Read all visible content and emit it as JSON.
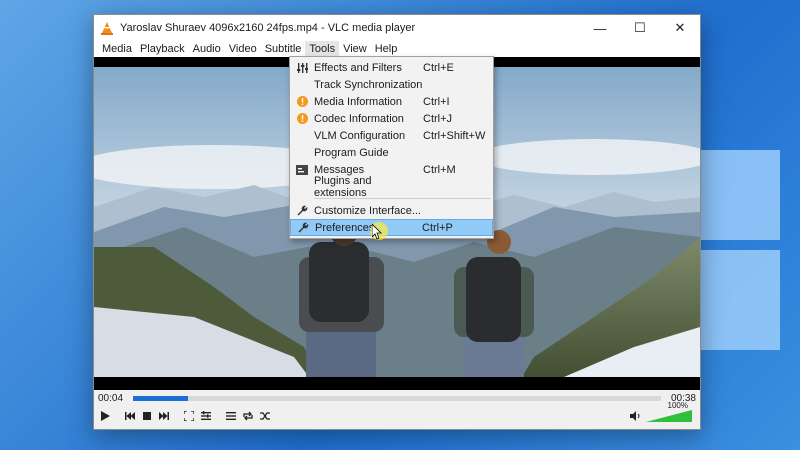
{
  "window": {
    "title": "Yaroslav Shuraev 4096x2160 24fps.mp4 - VLC media player",
    "minimize": "—",
    "maximize": "☐",
    "close": "✕"
  },
  "menubar": [
    "Media",
    "Playback",
    "Audio",
    "Video",
    "Subtitle",
    "Tools",
    "View",
    "Help"
  ],
  "tools_menu": {
    "items": [
      {
        "label": "Effects and Filters",
        "shortcut": "Ctrl+E",
        "icon": "equalizer-icon"
      },
      {
        "label": "Track Synchronization",
        "shortcut": "",
        "icon": ""
      },
      {
        "label": "Media Information",
        "shortcut": "Ctrl+I",
        "icon": "info-icon"
      },
      {
        "label": "Codec Information",
        "shortcut": "Ctrl+J",
        "icon": "info-icon"
      },
      {
        "label": "VLM Configuration",
        "shortcut": "Ctrl+Shift+W",
        "icon": ""
      },
      {
        "label": "Program Guide",
        "shortcut": "",
        "icon": ""
      },
      {
        "label": "Messages",
        "shortcut": "Ctrl+M",
        "icon": "messages-icon"
      },
      {
        "label": "Plugins and extensions",
        "shortcut": "",
        "icon": ""
      },
      {
        "label": "Customize Interface...",
        "shortcut": "",
        "icon": "wrench-icon"
      },
      {
        "label": "Preferences",
        "shortcut": "Ctrl+P",
        "icon": "wrench-icon"
      }
    ],
    "highlighted": "Preferences"
  },
  "playback": {
    "elapsed": "00:04",
    "total": "00:38",
    "progress": 0.105,
    "volume_label": "100%",
    "volume": 1.0
  },
  "colors": {
    "accent": "#1b6fd6",
    "menu_highlight": "#91c9f7",
    "info_icon": "#f39a1e"
  }
}
